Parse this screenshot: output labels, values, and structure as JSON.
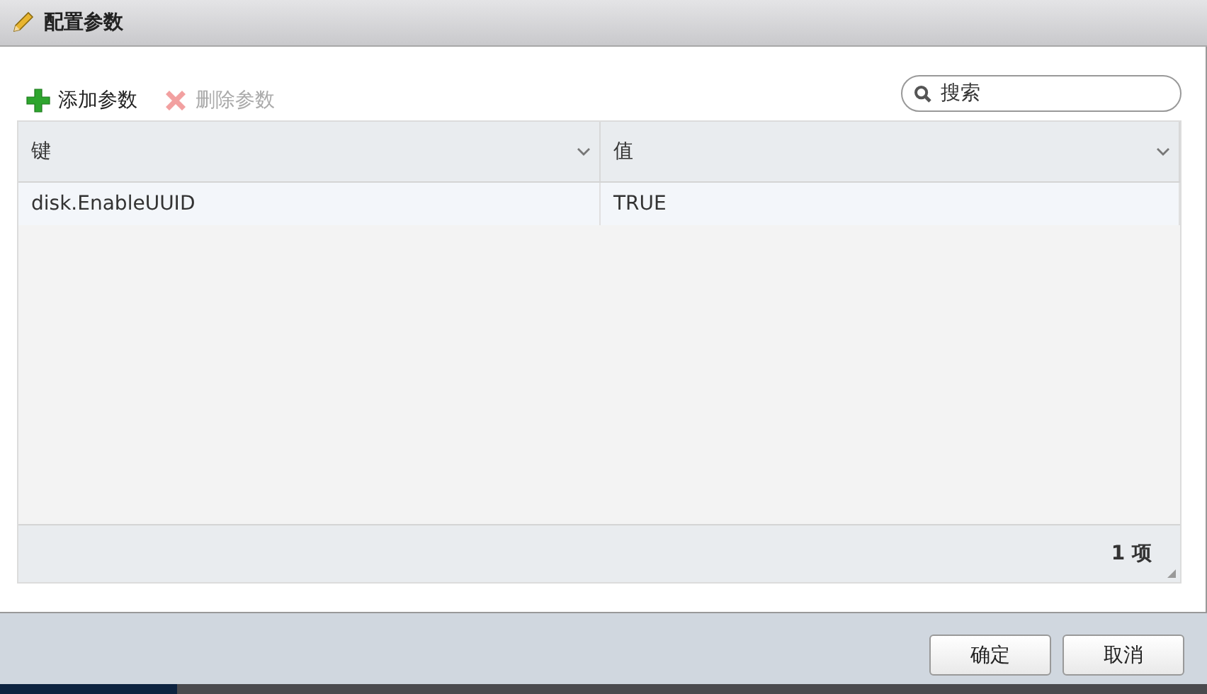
{
  "window": {
    "title": "配置参数"
  },
  "toolbar": [
    {
      "kind": "add",
      "label": "添加参数",
      "disabled": false
    },
    {
      "kind": "remove",
      "label": "删除参数",
      "disabled": true
    }
  ],
  "search": {
    "placeholder": "搜索"
  },
  "table": {
    "columns": [
      {
        "label": "键"
      },
      {
        "label": "值"
      }
    ],
    "rows": [
      {
        "cells": [
          "disk.EnableUUID",
          "TRUE"
        ]
      }
    ],
    "count": "1 项"
  },
  "buttons": [
    "确定",
    "取消"
  ]
}
